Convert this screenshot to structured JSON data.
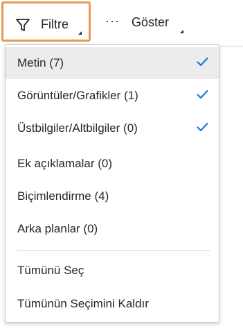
{
  "toolbar": {
    "filter_label": "Filtre",
    "show_label": "Göster",
    "show_dots": "···"
  },
  "colors": {
    "focus_border": "#e59a52",
    "check": "#1a73e8",
    "highlight_bg": "#ececec"
  },
  "menu": {
    "filter_items": [
      {
        "label": "Metin (7)",
        "checked": true,
        "highlighted": true
      },
      {
        "label": "Görüntüler/Grafikler (1)",
        "checked": true,
        "highlighted": false
      },
      {
        "label": "Üstbilgiler/Altbilgiler (0)",
        "checked": true,
        "highlighted": false
      },
      {
        "label": "Ek açıklamalar (0)",
        "checked": false,
        "highlighted": false
      },
      {
        "label": "Biçimlendirme (4)",
        "checked": false,
        "highlighted": false
      },
      {
        "label": "Arka planlar (0)",
        "checked": false,
        "highlighted": false
      }
    ],
    "select_all_label": "Tümünü Seç",
    "deselect_all_label": "Tümünün Seçimini Kaldır"
  }
}
